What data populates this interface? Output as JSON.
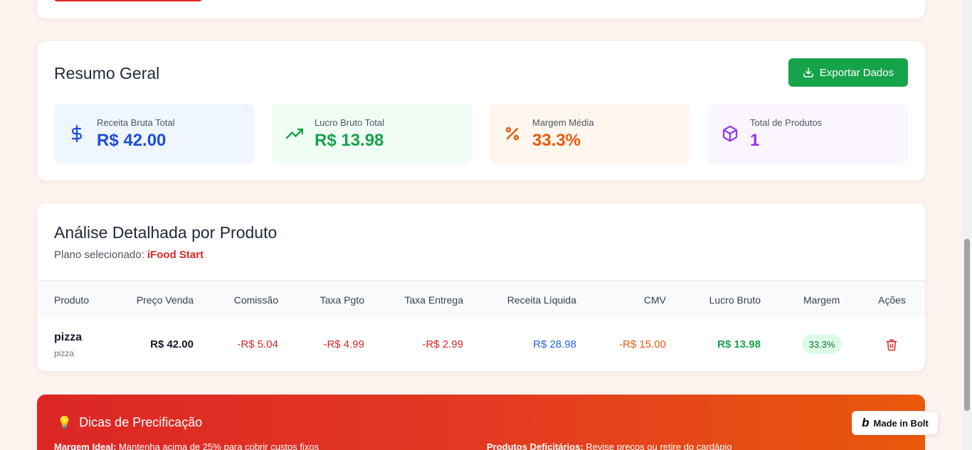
{
  "resumo": {
    "title": "Resumo Geral",
    "export_label": "Exportar Dados",
    "stats": [
      {
        "label": "Receita Bruta Total",
        "value": "R$ 42.00",
        "icon": "dollar-icon"
      },
      {
        "label": "Lucro Bruto Total",
        "value": "R$ 13.98",
        "icon": "trending-up-icon"
      },
      {
        "label": "Margem Média",
        "value": "33.3%",
        "icon": "percent-icon"
      },
      {
        "label": "Total de Produtos",
        "value": "1",
        "icon": "package-icon"
      }
    ]
  },
  "analise": {
    "title": "Análise Detalhada por Produto",
    "plano_label": "Plano selecionado: ",
    "plano_value": "iFood Start",
    "columns": [
      "Produto",
      "Preço Venda",
      "Comissão",
      "Taxa Pgto",
      "Taxa Entrega",
      "Receita Líquida",
      "CMV",
      "Lucro Bruto",
      "Margem",
      "Ações"
    ],
    "rows": [
      {
        "produto": "pizza",
        "categoria": "pizza",
        "preco_venda": "R$ 42.00",
        "comissao": "-R$ 5.04",
        "taxa_pgto": "-R$ 4.99",
        "taxa_entrega": "-R$ 2.99",
        "receita_liquida": "R$ 28.98",
        "cmv": "-R$ 15.00",
        "lucro_bruto": "R$ 13.98",
        "margem": "33.3%"
      }
    ]
  },
  "dicas": {
    "title": "Dicas de Precificação",
    "item1_label": "Margem Ideal:",
    "item1_text": " Mantenha acima de 25% para cobrir custos fixos",
    "item2_label": "Produtos Deficitários:",
    "item2_text": " Revise preços ou retire do cardápio"
  },
  "badge": {
    "label": "Made in Bolt"
  },
  "colors": {
    "accent_green": "#16a34a",
    "accent_red": "#dc2626",
    "blue": "#2563eb",
    "orange": "#ea580c",
    "purple": "#9333ea"
  }
}
